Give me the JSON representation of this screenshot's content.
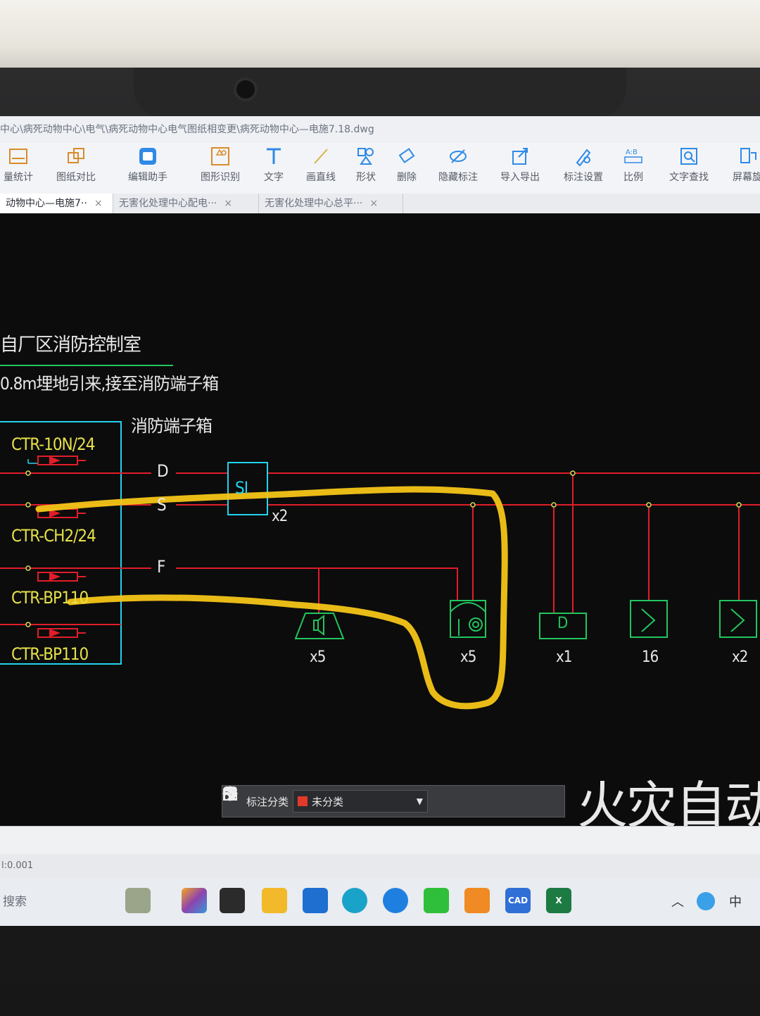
{
  "window": {
    "path": "中心\\病死动物中心\\电气\\病死动物中心电气图纸相变更\\病死动物中心—电施7.18.dwg"
  },
  "ribbon": {
    "items": [
      {
        "label": "量统计",
        "icon": "stats-icon"
      },
      {
        "label": "图纸对比",
        "icon": "compare-icon"
      },
      {
        "label": "编辑助手",
        "icon": "cad-edit-icon"
      },
      {
        "label": "图形识别",
        "icon": "shape-recognize-icon"
      },
      {
        "label": "文字",
        "icon": "text-icon"
      },
      {
        "label": "画直线",
        "icon": "line-icon"
      },
      {
        "label": "形状",
        "icon": "shapes-icon"
      },
      {
        "label": "删除",
        "icon": "eraser-icon"
      },
      {
        "label": "隐藏标注",
        "icon": "hide-icon"
      },
      {
        "label": "导入导出",
        "icon": "import-export-icon"
      },
      {
        "label": "标注设置",
        "icon": "annotation-settings-icon"
      },
      {
        "label": "比例",
        "icon": "scale-icon"
      },
      {
        "label": "文字查找",
        "icon": "text-search-icon"
      },
      {
        "label": "屏幕旋",
        "icon": "screen-rotate-icon"
      }
    ]
  },
  "tabs": [
    {
      "label": "动物中心—电施7··",
      "active": true
    },
    {
      "label": "无害化处理中心配电···",
      "active": false
    },
    {
      "label": "无害化处理中心总平···",
      "active": false
    }
  ],
  "drawing": {
    "room_label": "自厂区消防控制室",
    "cable_note": "0.8m埋地引来,接至消防端子箱",
    "terminal_box": "消防端子箱",
    "modules": [
      "CTR-10N/24",
      "CTR-CH2/24",
      "CTR-BP110",
      "CTR-BP110"
    ],
    "bus_labels": [
      "D",
      "S",
      "F"
    ],
    "si_label": "SI",
    "si_qty": "x2",
    "devices": [
      {
        "symbol": "speaker",
        "qty": "x5"
      },
      {
        "symbol": "bell",
        "qty": "x5"
      },
      {
        "symbol": "D",
        "qty": "x1"
      },
      {
        "symbol": "S",
        "qty": "16"
      },
      {
        "symbol": "S",
        "qty": "x2"
      }
    ],
    "title_big": "火灾自动报警"
  },
  "float_toolbar": {
    "menu_label": "标注分类",
    "category": "未分类",
    "category_color": "#e23a2a"
  },
  "status": {
    "text": "l:0.001"
  },
  "taskbar": {
    "search_label": "搜索",
    "ime": "中"
  }
}
